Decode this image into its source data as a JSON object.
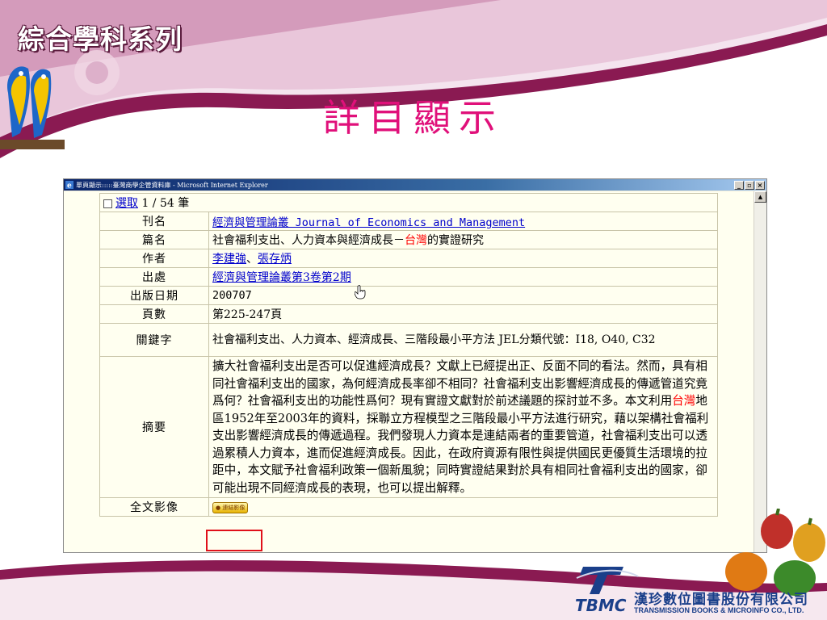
{
  "slide": {
    "brand": "綜合學科系列",
    "title": "詳目顯示",
    "company_cn": "漢珍數位圖書股份有限公司",
    "company_en": "TRANSMISSION BOOKS & MICROINFO CO., LTD.",
    "logo_text": "TBMC",
    "accent_color": "#e0107a",
    "band_color": "#8a1a52"
  },
  "window": {
    "title": "單頁顯示:::::臺灣商學企管資料庫 - Microsoft Internet Explorer",
    "buttons": {
      "minimize": "_",
      "maximize": "▫",
      "close": "×"
    }
  },
  "record": {
    "select_label": "選取",
    "position": "1 / 54 筆",
    "fields": {
      "journal_label": "刊名",
      "journal_value": "經濟與管理論叢 Journal of Economics and Management",
      "title_label": "篇名",
      "title_before": "社會福利支出、人力資本與經濟成長－",
      "title_highlight": "台灣",
      "title_after": "的實證研究",
      "author_label": "作者",
      "author_1": "李建強",
      "author_sep": "、",
      "author_2": "張存炳",
      "source_label": "出處",
      "source_value": "經濟與管理論叢第3卷第2期",
      "date_label": "出版日期",
      "date_value": "200707",
      "pages_label": "頁數",
      "pages_value": "第225-247頁",
      "keywords_label": "關鍵字",
      "keywords_value": "社會福利支出、人力資本、經濟成長、三階段最小平方法 JEL分類代號：I18, O40, C32",
      "abstract_label": "摘要",
      "abstract_before": "擴大社會福利支出是否可以促進經濟成長？文獻上已經提出正、反面不同的看法。然而，具有相同社會福利支出的國家，為何經濟成長率卻不相同？社會福利支出影響經濟成長的傳遞管道究竟爲何？社會福利支出的功能性爲何？現有實證文獻對於前述議題的探討並不多。本文利用",
      "abstract_highlight": "台灣",
      "abstract_after": "地區1952年至2003年的資料，採聯立方程模型之三階段最小平方法進行研究，藉以架構社會福利支出影響經濟成長的傳遞過程。我們發現人力資本是連結兩者的重要管道，社會福利支出可以透過累積人力資本，進而促進經濟成長。因此，在政府資源有限性與提供國民更優質生活環境的拉距中，本文賦予社會福利政策一個新風貌；同時實證結果對於具有相同社會福利支出的國家，卻可能出現不同經濟成長的表現，也可以提出解釋。",
      "fulltext_label": "全文影像",
      "fulltext_button": "連結影像"
    }
  }
}
